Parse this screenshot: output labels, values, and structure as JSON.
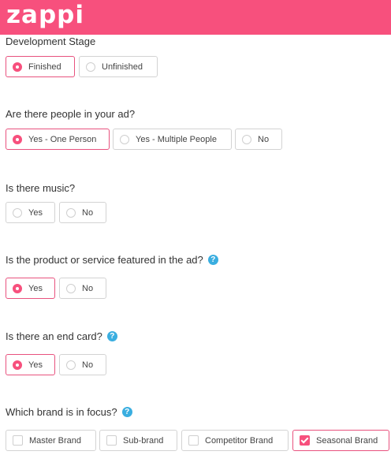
{
  "brand": {
    "logo_text": "zappi",
    "color": "#f7507d"
  },
  "questions": [
    {
      "label": "Development Stage",
      "options": [
        {
          "label": "Finished",
          "selected": true
        },
        {
          "label": "Unfinished",
          "selected": false
        }
      ]
    },
    {
      "label": "Are there people in your ad?",
      "options": [
        {
          "label": "Yes - One Person",
          "selected": true
        },
        {
          "label": "Yes - Multiple People",
          "selected": false
        },
        {
          "label": "No",
          "selected": false
        }
      ]
    },
    {
      "label": "Is there music?",
      "options": [
        {
          "label": "Yes",
          "selected": false
        },
        {
          "label": "No",
          "selected": false
        }
      ]
    },
    {
      "label": "Is the product or service featured in the ad?",
      "help_icon": "question-circle-icon",
      "options": [
        {
          "label": "Yes",
          "selected": true
        },
        {
          "label": "No",
          "selected": false
        }
      ]
    },
    {
      "label": "Is there an end card?",
      "help_icon": "question-circle-icon",
      "options": [
        {
          "label": "Yes",
          "selected": true
        },
        {
          "label": "No",
          "selected": false
        }
      ]
    },
    {
      "label": "Which brand is in focus?",
      "help_icon": "question-circle-icon",
      "input_type": "checkbox",
      "options": [
        {
          "label": "Master Brand",
          "selected": false
        },
        {
          "label": "Sub-brand",
          "selected": false
        },
        {
          "label": "Competitor Brand",
          "selected": false
        },
        {
          "label": "Seasonal Brand",
          "selected": true
        }
      ]
    }
  ],
  "help_glyph": "?",
  "colors": {
    "selected_border": "#e8527e",
    "help": "#3aaee0"
  }
}
